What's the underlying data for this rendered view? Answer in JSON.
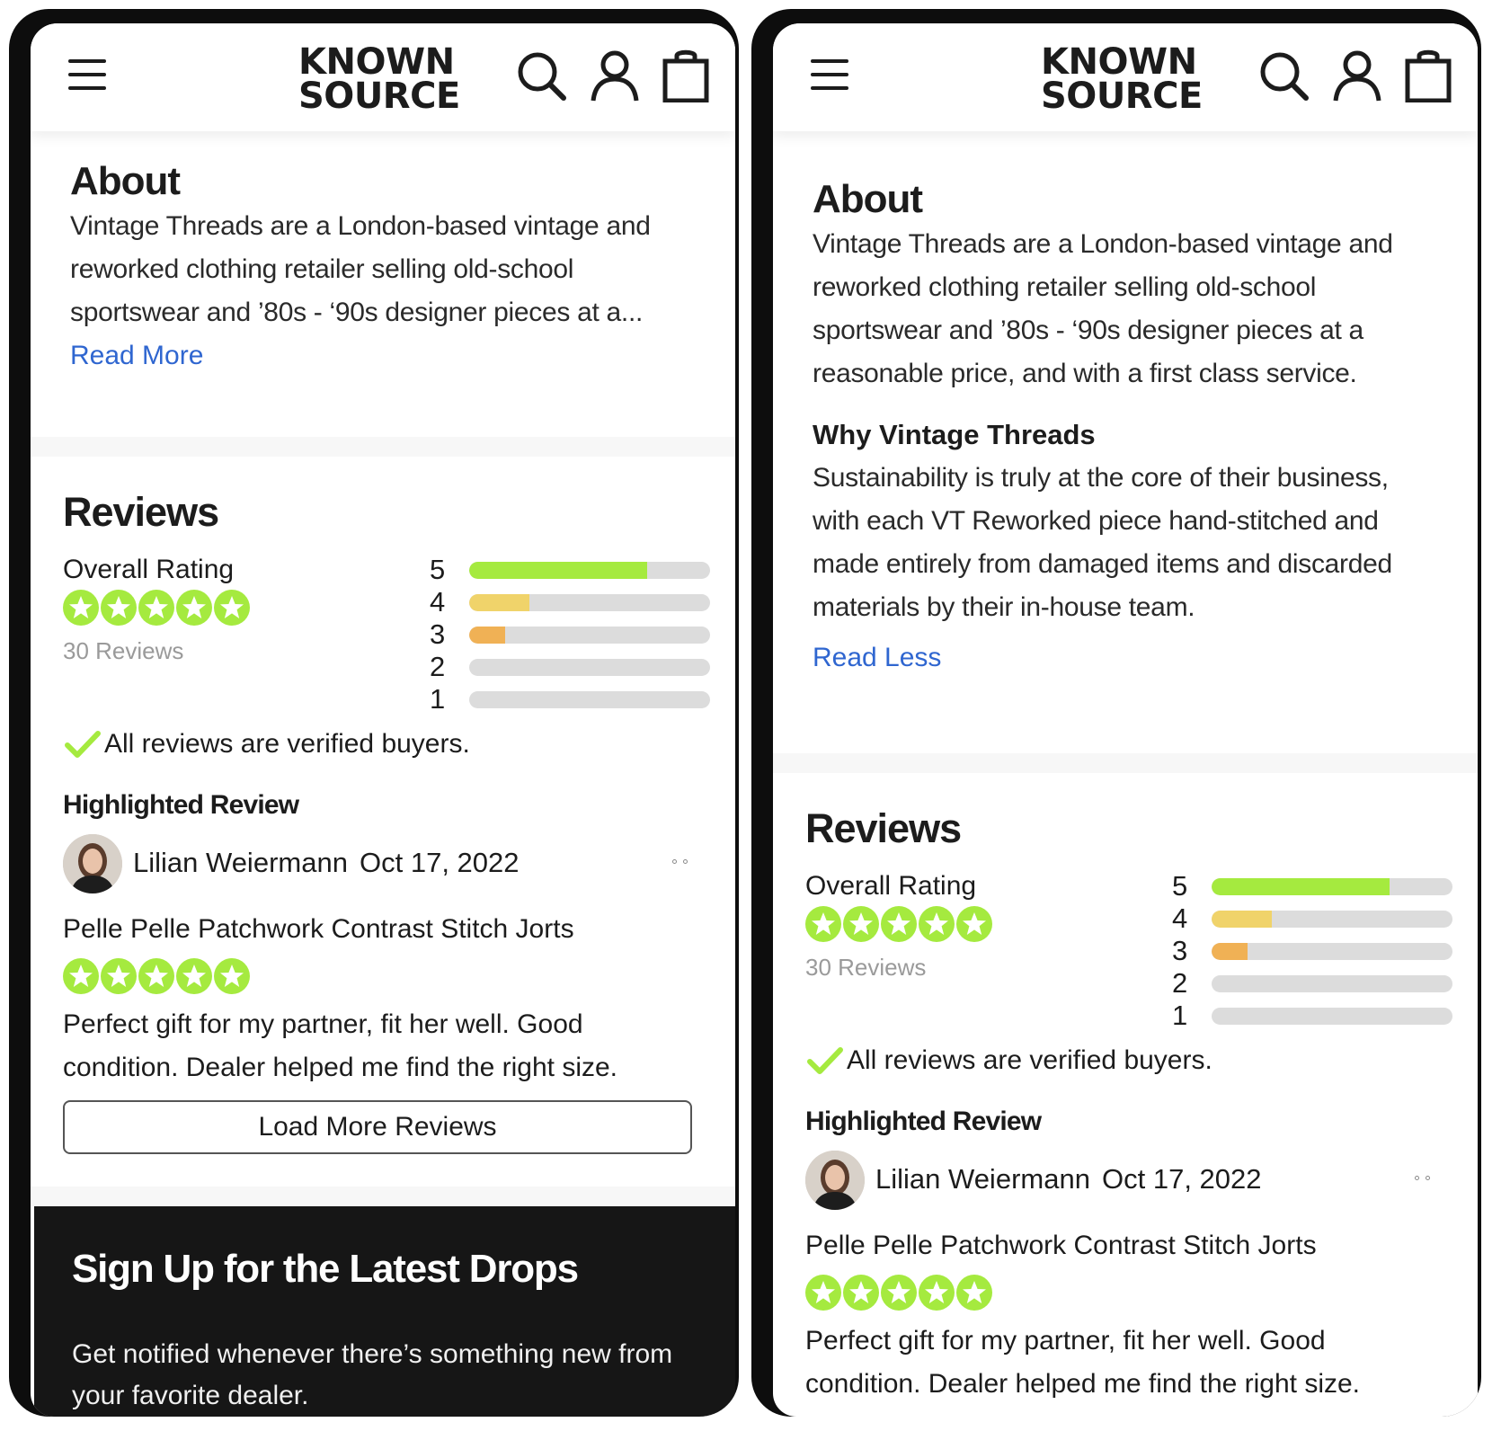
{
  "brand": {
    "logo_line1": "KNOWN",
    "logo_line2": "SOURCE",
    "text_color": "#1c1c1c"
  },
  "header": {
    "icons": [
      "menu-icon",
      "search-icon",
      "account-icon",
      "shopping-bag-icon"
    ]
  },
  "about": {
    "title": "About",
    "description_truncated": "Vintage Threads are a London-based vintage and reworked clothing retailer selling old-school sportswear and ’80s - ‘90s designer pieces at a...",
    "description_full": "Vintage Threads are a London-based vintage and reworked clothing retailer selling old-school sportswear and ’80s - ‘90s designer pieces at a reasonable price, and with a first class service.",
    "why_title": "Why Vintage Threads",
    "why_text": "Sustainability is truly at the core of their business, with each VT Reworked piece hand-stitched and made entirely from damaged items and discarded materials by their in-house team.",
    "read_more": "Read More",
    "read_less": "Read Less",
    "link_color": "#2f66d0"
  },
  "reviews": {
    "title": "Reviews",
    "overall_label": "Overall Rating",
    "overall_stars": 5,
    "count_text": "30 Reviews",
    "star_color": "#a5ea3f",
    "distribution": [
      {
        "stars": "5",
        "fraction": 0.74,
        "color": "#a5ea3f"
      },
      {
        "stars": "4",
        "fraction": 0.25,
        "color": "#f0d36a"
      },
      {
        "stars": "3",
        "fraction": 0.15,
        "color": "#f0b155"
      },
      {
        "stars": "2",
        "fraction": 0,
        "color": "#dcdcdc"
      },
      {
        "stars": "1",
        "fraction": 0,
        "color": "#dcdcdc"
      }
    ],
    "verified_text": "All reviews are verified buyers.",
    "highlighted_title": "Highlighted Review",
    "highlighted": {
      "reviewer": "Lilian Weiermann",
      "date": "Oct 17, 2022",
      "product": "Pelle Pelle Patchwork Contrast Stitch Jorts",
      "stars": 5,
      "body": "Perfect gift for my partner, fit her well. Good condition. Dealer helped me find the right size."
    },
    "load_more": "Load More Reviews"
  },
  "signup": {
    "title": "Sign Up for the Latest Drops",
    "text": "Get notified whenever there’s something new from your favorite dealer."
  }
}
